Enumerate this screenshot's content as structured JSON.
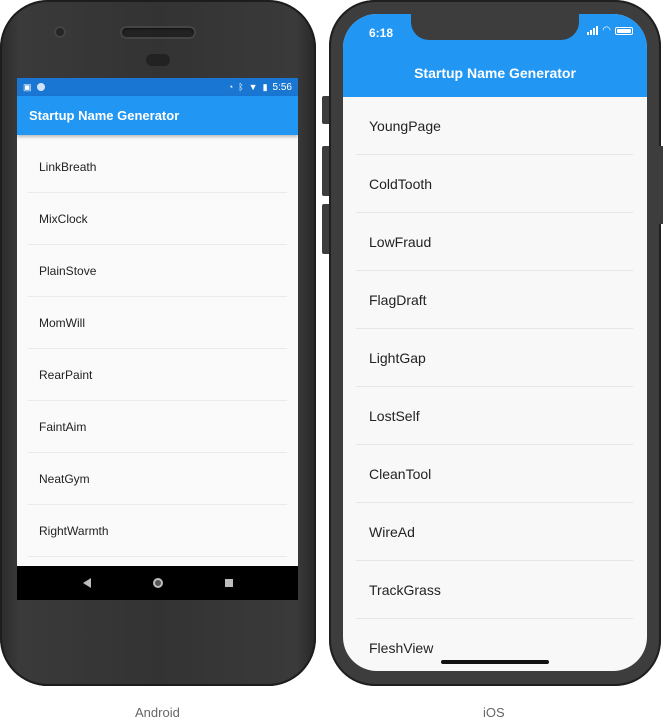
{
  "android": {
    "caption": "Android",
    "status_time": "5:56",
    "app_title": "Startup Name Generator",
    "items": [
      "LinkBreath",
      "MixClock",
      "PlainStove",
      "MomWill",
      "RearPaint",
      "FaintAim",
      "NeatGym",
      "RightWarmth"
    ],
    "icons": [
      "sim-alert-icon",
      "notification-dot-icon",
      "data-saver-icon",
      "bluetooth-icon",
      "wifi-icon",
      "battery-icon",
      "back-icon",
      "home-icon",
      "recents-icon"
    ]
  },
  "ios": {
    "caption": "iOS",
    "status_time": "6:18",
    "app_title": "Startup Name Generator",
    "items": [
      "YoungPage",
      "ColdTooth",
      "LowFraud",
      "FlagDraft",
      "LightGap",
      "LostSelf",
      "CleanTool",
      "WireAd",
      "TrackGrass",
      "FleshView"
    ],
    "icons": [
      "signal-icon",
      "wifi-icon",
      "battery-icon"
    ]
  },
  "colors": {
    "appbar": "#2196f3",
    "android_statusbar": "#1976d2",
    "phone_frame": "#3d3d3d"
  }
}
